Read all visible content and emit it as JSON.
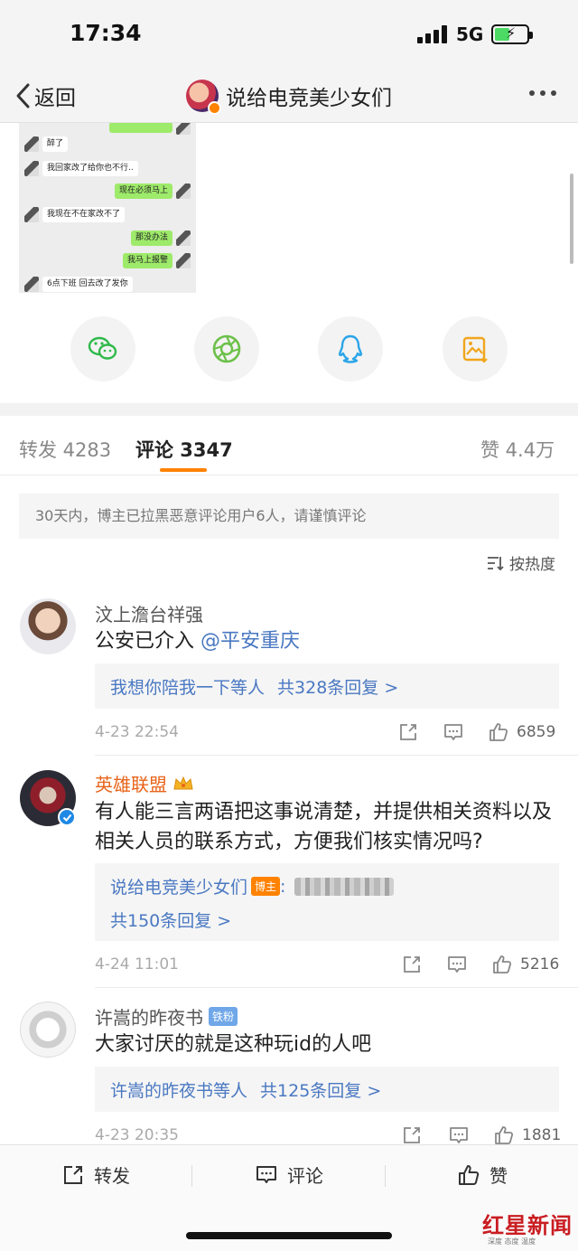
{
  "status_bar": {
    "time": "17:34",
    "network": "5G"
  },
  "nav": {
    "back_label": "返回",
    "title": "说给电竞美少女们"
  },
  "chat_screenshot": [
    {
      "side": "left",
      "text": "醉了"
    },
    {
      "side": "left",
      "text": "我回家改了给你也不行.."
    },
    {
      "side": "right",
      "text": "现在必须马上"
    },
    {
      "side": "left",
      "text": "我现在不在家改不了"
    },
    {
      "side": "right",
      "text": "那没办法"
    },
    {
      "side": "right",
      "text": "我马上报警"
    },
    {
      "side": "left",
      "text": "6点下班 回去改了发你"
    }
  ],
  "share_icons": [
    "wechat-icon",
    "moments-icon",
    "qq-icon",
    "save-image-icon"
  ],
  "tabs": {
    "repost": "转发 4283",
    "comment": "评论 3347",
    "like": "赞 4.4万"
  },
  "notice": "30天内，博主已拉黑恶意评论用户6人，请谨慎评论",
  "sort_label": "按热度",
  "comments": [
    {
      "name": "汶上澹台祥强",
      "text_plain": "公安已介入",
      "mention": "@平安重庆",
      "reply_text": "我想你陪我一下等人",
      "reply_count": "共328条回复 >",
      "time": "4-23 22:54",
      "likes": "6859"
    },
    {
      "name": "英雄联盟",
      "text": "有人能三言两语把这事说清楚，并提供相关资料以及相关人员的联系方式，方便我们核实情况吗?",
      "reply_author": "说给电竞美少女们",
      "reply_host_tag": "博主",
      "reply_count": "共150条回复 >",
      "time": "4-24 11:01",
      "likes": "5216"
    },
    {
      "name": "许嵩的昨夜书",
      "badge": "铁粉",
      "text": "大家讨厌的就是这种玩id的人吧",
      "reply_text": "许嵩的昨夜书等人",
      "reply_count": "共125条回复 >",
      "time": "4-23 20:35",
      "likes": "1881"
    }
  ],
  "bottom_bar": {
    "repost": "转发",
    "comment": "评论",
    "like": "赞"
  },
  "watermark": {
    "main": "红星新闻",
    "sub": "深度 态度 温度"
  },
  "colors": {
    "accent": "#ff8200",
    "link": "#4a78c2",
    "wechat_green": "#9eea6a"
  }
}
